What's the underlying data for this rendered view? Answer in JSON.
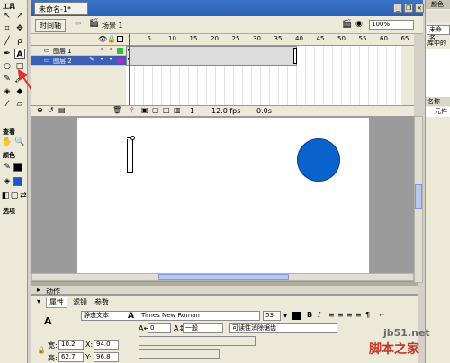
{
  "tools": {
    "title": "工具",
    "view": "查看",
    "color": "颜色",
    "options": "选项"
  },
  "document": {
    "tab": "未命名-1*"
  },
  "toolbar": {
    "timeline_btn": "时间轴",
    "scene": "场景 1",
    "zoom": "100%"
  },
  "timeline": {
    "frame_numbers": [
      "1",
      "5",
      "10",
      "15",
      "20",
      "25",
      "30",
      "35",
      "40",
      "45",
      "50",
      "55",
      "60",
      "65"
    ],
    "layers": [
      {
        "name": "图层 1",
        "selected": false
      },
      {
        "name": "图层 2",
        "selected": true
      }
    ],
    "status_frame": "1",
    "status_fps": "12.0 fps",
    "status_time": "0.0s"
  },
  "stage": {
    "circle_color": "#0a63cc"
  },
  "props": {
    "actions_tab": "动作",
    "tabs": [
      "属性",
      "滤镜",
      "参数"
    ],
    "text_type": "静态文本",
    "font": "Times New Roman",
    "size": "53",
    "spacing": "0",
    "baseline": "一般",
    "rendering": "可读性消除锯齿",
    "w_label": "宽:",
    "w": "10.2",
    "x_label": "X:",
    "x": "94.0",
    "h_label": "高:",
    "h": "62.7",
    "y_label": "Y:",
    "y": "96.8"
  },
  "right_panel": {
    "top": "颜色",
    "untitled": "未命名",
    "library": "库中的",
    "name": "名称",
    "item": "元件"
  },
  "watermark": {
    "site": "jb51.net",
    "brand": "脚本之家"
  }
}
